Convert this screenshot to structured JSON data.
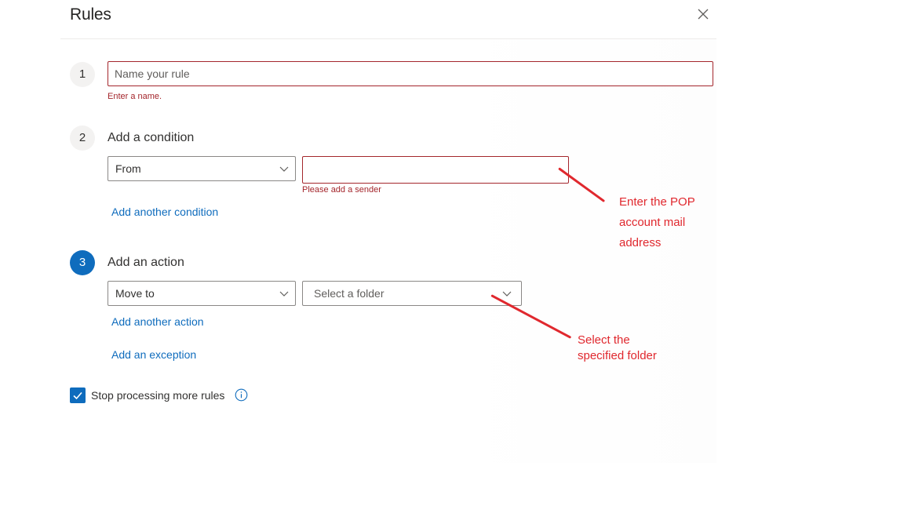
{
  "dialog": {
    "title": "Rules"
  },
  "step1": {
    "number": "1",
    "name_input": {
      "placeholder": "Name your rule",
      "value": ""
    },
    "error": "Enter a name."
  },
  "step2": {
    "number": "2",
    "label": "Add a condition",
    "condition_dropdown": "From",
    "sender_input": {
      "placeholder": "",
      "value": ""
    },
    "error": "Please add a sender",
    "add_link": "Add another condition"
  },
  "step3": {
    "number": "3",
    "label": "Add an action",
    "action_dropdown": "Move to",
    "folder_dropdown": "Select a folder",
    "add_link": "Add another action",
    "exception_link": "Add an exception"
  },
  "options": {
    "stop_processing_label": "Stop processing more rules",
    "stop_processing_checked": true
  },
  "annotations": {
    "sender": [
      "Enter the POP",
      "account mail",
      "address"
    ],
    "folder": [
      "Select the",
      "specified folder"
    ]
  },
  "colors": {
    "accent": "#0f6cbd",
    "error": "#a4262c",
    "annotation": "#e0282e"
  },
  "icons": {
    "close": "close-icon",
    "chevron": "chevron-down-icon",
    "check": "checkmark-icon",
    "info": "info-icon"
  }
}
